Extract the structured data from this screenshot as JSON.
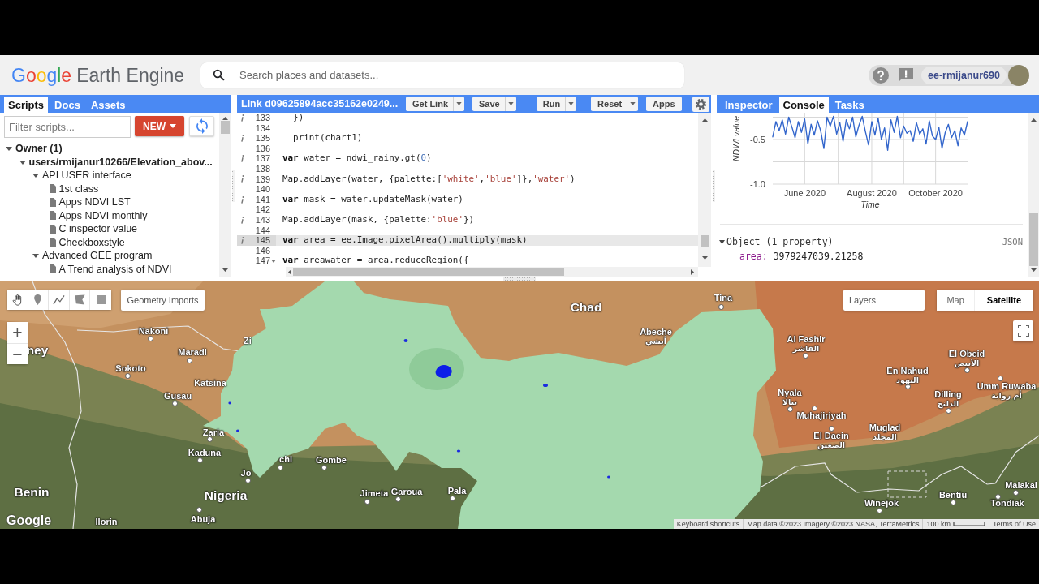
{
  "header": {
    "logo": {
      "brand": "Google",
      "product": "Earth Engine"
    },
    "search": {
      "placeholder": "Search places and datasets..."
    },
    "account": {
      "username": "ee-rmijanur690"
    }
  },
  "scripts_panel": {
    "tabs": [
      {
        "label": "Scripts",
        "selected": true
      },
      {
        "label": "Docs",
        "selected": false
      },
      {
        "label": "Assets",
        "selected": false
      }
    ],
    "filter": {
      "placeholder": "Filter scripts..."
    },
    "new_button": {
      "label": "NEW"
    },
    "tree": [
      {
        "label": "Owner (1)",
        "kind": "owner",
        "expanded": true,
        "children": [
          {
            "label": "users/rmijanur10266/Elevation_abov...",
            "kind": "repo",
            "expanded": true,
            "children": [
              {
                "label": "API USER interface",
                "kind": "folder",
                "expanded": true,
                "children": [
                  {
                    "label": "1st class",
                    "kind": "file"
                  },
                  {
                    "label": "Apps NDVI LST",
                    "kind": "file"
                  },
                  {
                    "label": "Apps NDVI monthly",
                    "kind": "file"
                  },
                  {
                    "label": "C inspector value",
                    "kind": "file"
                  },
                  {
                    "label": "Checkboxstyle",
                    "kind": "file"
                  }
                ]
              },
              {
                "label": "Advanced GEE program",
                "kind": "folder",
                "expanded": true,
                "children": [
                  {
                    "label": "A Trend analysis of NDVI",
                    "kind": "file"
                  }
                ]
              }
            ]
          }
        ]
      }
    ]
  },
  "editor": {
    "title": "Link d09625894acc35162e0249...",
    "buttons": [
      {
        "label": "Get Link",
        "dropdown": true
      },
      {
        "label": "Save",
        "dropdown": true
      },
      {
        "label": "Run",
        "dropdown": true
      },
      {
        "label": "Reset",
        "dropdown": true
      },
      {
        "label": "Apps",
        "dropdown": false
      }
    ],
    "lines": [
      {
        "number": "133",
        "info": true,
        "current": false,
        "foldable": false,
        "tokens": [
          {
            "text": "  })",
            "kind": "plain"
          }
        ]
      },
      {
        "number": "134",
        "info": false,
        "current": false,
        "foldable": false
      },
      {
        "number": "135",
        "info": true,
        "current": false,
        "foldable": false,
        "tokens": [
          {
            "text": "  print(chart1)",
            "kind": "plain"
          }
        ]
      },
      {
        "number": "136",
        "info": false,
        "current": false,
        "foldable": false
      },
      {
        "number": "137",
        "info": true,
        "current": false,
        "foldable": false,
        "tokens": [
          {
            "text": "var",
            "kind": "keyword"
          },
          {
            "text": " water = ndwi_rainy.gt(",
            "kind": "plain"
          },
          {
            "text": "0",
            "kind": "number"
          },
          {
            "text": ")",
            "kind": "plain"
          }
        ]
      },
      {
        "number": "138",
        "info": false,
        "current": false,
        "foldable": false
      },
      {
        "number": "139",
        "info": true,
        "current": false,
        "foldable": false,
        "tokens": [
          {
            "text": "Map.addLayer(water, {palette:[",
            "kind": "plain"
          },
          {
            "text": "'white'",
            "kind": "string"
          },
          {
            "text": ",",
            "kind": "plain"
          },
          {
            "text": "'blue'",
            "kind": "string"
          },
          {
            "text": "]},",
            "kind": "plain"
          },
          {
            "text": "'water'",
            "kind": "string"
          },
          {
            "text": ")",
            "kind": "plain"
          }
        ]
      },
      {
        "number": "140",
        "info": false,
        "current": false,
        "foldable": false
      },
      {
        "number": "141",
        "info": true,
        "current": false,
        "foldable": false,
        "tokens": [
          {
            "text": "var",
            "kind": "keyword"
          },
          {
            "text": " mask = water.updateMask(water)",
            "kind": "plain"
          }
        ]
      },
      {
        "number": "142",
        "info": false,
        "current": false,
        "foldable": false
      },
      {
        "number": "143",
        "info": true,
        "current": false,
        "foldable": false,
        "tokens": [
          {
            "text": "Map.addLayer(mask, {palette:",
            "kind": "plain"
          },
          {
            "text": "'blue'",
            "kind": "string"
          },
          {
            "text": "})",
            "kind": "plain"
          }
        ]
      },
      {
        "number": "144",
        "info": false,
        "current": false,
        "foldable": false
      },
      {
        "number": "145",
        "info": true,
        "current": true,
        "foldable": false,
        "tokens": [
          {
            "text": "var",
            "kind": "keyword"
          },
          {
            "text": " area = ee.Image.pixelArea().multiply(mask)",
            "kind": "plain"
          }
        ]
      },
      {
        "number": "146",
        "info": false,
        "current": false,
        "foldable": false
      },
      {
        "number": "147",
        "info": false,
        "current": false,
        "foldable": true,
        "tokens": [
          {
            "text": "var",
            "kind": "keyword"
          },
          {
            "text": " areawater = area.reduceRegion({",
            "kind": "plain"
          }
        ]
      }
    ]
  },
  "output_panel": {
    "tabs": [
      {
        "label": "Inspector",
        "selected": false
      },
      {
        "label": "Console",
        "selected": true
      },
      {
        "label": "Tasks",
        "selected": false
      }
    ],
    "chart_data": {
      "type": "line",
      "xlabel": "Time",
      "ylabel": "NDWI value",
      "grid": true,
      "categories": [
        null,
        null,
        null,
        null,
        null,
        null,
        null,
        null,
        null,
        null,
        "June 2020",
        null,
        null,
        null,
        null,
        null,
        null,
        null,
        null,
        null,
        null,
        null,
        null,
        null,
        null,
        null,
        null,
        null,
        null,
        null,
        null,
        "August 2020",
        null,
        null,
        null,
        null,
        null,
        null,
        null,
        null,
        null,
        null,
        null,
        null,
        null,
        null,
        null,
        null,
        null,
        null,
        null,
        "October 2020",
        null,
        null,
        null,
        null,
        null,
        null,
        null,
        null,
        null,
        null
      ],
      "values": [
        -0.47,
        -0.3,
        -0.4,
        -0.28,
        -0.44,
        -0.25,
        -0.36,
        -0.48,
        -0.3,
        -0.42,
        -0.27,
        -0.55,
        -0.33,
        -0.45,
        -0.29,
        -0.4,
        -0.6,
        -0.25,
        -0.35,
        -0.24,
        -0.44,
        -0.31,
        -0.52,
        -0.28,
        -0.38,
        -0.25,
        -0.47,
        -0.34,
        -0.24,
        -0.41,
        -0.56,
        -0.3,
        -0.45,
        -0.26,
        -0.5,
        -0.37,
        -0.62,
        -0.28,
        -0.42,
        -0.24,
        -0.48,
        -0.35,
        -0.43,
        -0.4,
        -0.52,
        -0.31,
        -0.44,
        -0.38,
        -0.55,
        -0.29,
        -0.46,
        -0.5,
        -0.36,
        -0.6,
        -0.42,
        -0.33,
        -0.48,
        -0.4,
        -0.57,
        -0.37,
        -0.45,
        -0.3
      ],
      "ylim": [
        -1.0,
        -0.2
      ],
      "yticks": [
        {
          "value": -1.0,
          "label": "-1.0"
        },
        {
          "value": -0.5,
          "label": "-0.5"
        }
      ]
    },
    "object": {
      "title": "Object (1 property)",
      "expanded": true,
      "format": "JSON",
      "properties": [
        {
          "key": "area:",
          "value": "3979247039.21258"
        }
      ]
    }
  },
  "map": {
    "labels": [
      {
        "text": "Tina",
        "kind": "city",
        "dot": true
      },
      {
        "text": "Chad",
        "kind": "country",
        "dot": false
      },
      {
        "text": "Nakoni",
        "kind": "city",
        "dot": true
      },
      {
        "text": "Zi",
        "kind": "city",
        "dot": false
      },
      {
        "text": "Abeche",
        "local": "أبشي",
        "kind": "city",
        "dot": false
      },
      {
        "text": "ney",
        "kind": "country",
        "dot": false
      },
      {
        "text": "Maradi",
        "kind": "city",
        "dot": true
      },
      {
        "text": "Al Fashir",
        "local": "الفاشر",
        "kind": "city",
        "dot": true
      },
      {
        "text": "El Obeid",
        "local": "الأبيض",
        "kind": "city",
        "dot": true
      },
      {
        "text": "Sokoto",
        "kind": "city",
        "dot": true
      },
      {
        "text": "Katsina",
        "kind": "city",
        "dot": false
      },
      {
        "text": "En Nahud",
        "local": "النهود",
        "kind": "city",
        "dot": true
      },
      {
        "text": "Gusau",
        "kind": "city",
        "dot": true
      },
      {
        "text": "Nyala",
        "local": "نيالا",
        "kind": "city",
        "dot": true
      },
      {
        "text": "Dilling",
        "local": "الدلنج",
        "kind": "city",
        "dot": true
      },
      {
        "text": "Umm Ruwaba",
        "local": "أم روابة",
        "kind": "city",
        "dot": true
      },
      {
        "text": "Muhajiriyah",
        "kind": "city",
        "dot": true
      },
      {
        "text": "Zaria",
        "kind": "city",
        "dot": true
      },
      {
        "text": "El Daein",
        "local": "الضعين",
        "kind": "city",
        "dot": true
      },
      {
        "text": "Muglad",
        "local": "المجلد",
        "kind": "city",
        "dot": false
      },
      {
        "text": "Kaduna",
        "kind": "city",
        "dot": true
      },
      {
        "text": "chi",
        "kind": "city",
        "dot": true
      },
      {
        "text": "Gombe",
        "kind": "city",
        "dot": true
      },
      {
        "text": "Jo",
        "kind": "city",
        "dot": true
      },
      {
        "text": "Benin",
        "kind": "country",
        "dot": false
      },
      {
        "text": "Malakal",
        "kind": "city",
        "dot": true
      },
      {
        "text": "Nigeria",
        "kind": "country",
        "dot": false
      },
      {
        "text": "Jimeta",
        "kind": "city",
        "dot": true
      },
      {
        "text": "Garoua",
        "kind": "city",
        "dot": true
      },
      {
        "text": "Pala",
        "kind": "city",
        "dot": true
      },
      {
        "text": "Bentiu",
        "kind": "city",
        "dot": true
      },
      {
        "text": "Winejok",
        "kind": "city",
        "dot": true
      },
      {
        "text": "Tondiak",
        "kind": "city",
        "dot": true
      },
      {
        "text": "Ilorin",
        "kind": "city",
        "dot": false
      },
      {
        "text": "Abuja",
        "kind": "city",
        "dot": true
      }
    ],
    "geometry_imports": "Geometry Imports",
    "zoom": {
      "in": "+",
      "out": "−"
    },
    "layers": "Layers",
    "map_types": [
      {
        "label": "Map",
        "selected": false
      },
      {
        "label": "Satellite",
        "selected": true
      }
    ],
    "google_logo": "Google",
    "attribution": {
      "shortcuts": "Keyboard shortcuts",
      "data": "Map data ©2023 Imagery ©2023 NASA, TerraMetrics",
      "scale": "100 km",
      "terms": "Terms of Use"
    }
  }
}
